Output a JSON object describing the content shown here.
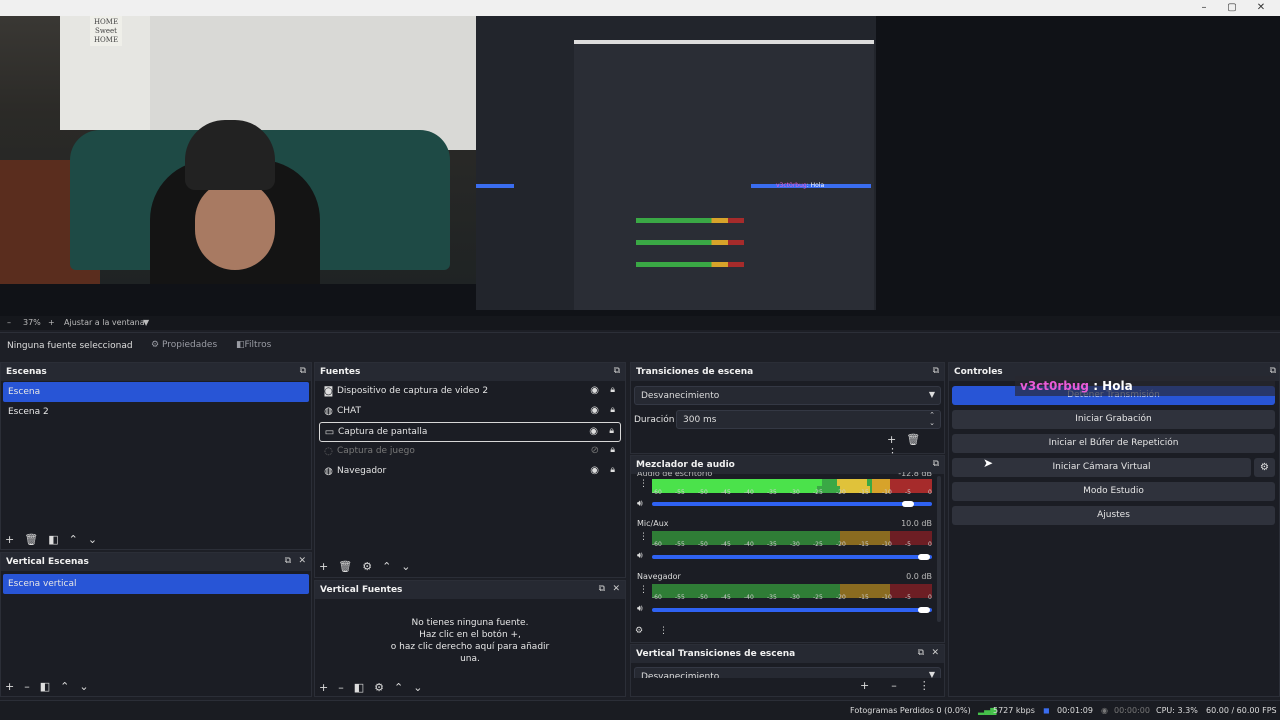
{
  "window": {
    "minimize": "–",
    "maximize": "▢",
    "close": "✕"
  },
  "preview": {
    "sign_text": "HOME Sweet HOME",
    "nested_chat_user": "v3ct0rbug",
    "nested_chat_msg": ": Hola"
  },
  "zoom": {
    "minus": "–",
    "percent": "37%",
    "plus": "+",
    "fit_label": "Ajustar a la ventana"
  },
  "source_toolbar": {
    "selected": "Ninguna fuente seleccionad",
    "properties": "Propiedades",
    "filters": "Filtros"
  },
  "scenes": {
    "title": "Escenas",
    "items": [
      {
        "label": "Escena",
        "selected": true
      },
      {
        "label": "Escena 2",
        "selected": false
      }
    ]
  },
  "sources": {
    "title": "Fuentes",
    "items": [
      {
        "label": "Dispositivo de captura de video 2",
        "icon": "camera-icon"
      },
      {
        "label": "CHAT",
        "icon": "globe-icon"
      },
      {
        "label": "Captura de pantalla",
        "icon": "monitor-icon"
      },
      {
        "label": "Captura de juego",
        "icon": "gamepad-icon"
      },
      {
        "label": "Navegador",
        "icon": "globe-icon"
      }
    ]
  },
  "transitions": {
    "title": "Transiciones de escena",
    "selected": "Desvanecimiento",
    "duration_label": "Duración",
    "duration_value": "300 ms"
  },
  "mixer": {
    "title": "Mezclador de audio",
    "top_label": "Audio de escritorio",
    "top_db": "-12.8 dB",
    "channels": [
      {
        "name": "Mic/Aux",
        "db": "10.0 dB"
      },
      {
        "name": "Navegador",
        "db": "0.0 dB"
      }
    ],
    "scale": [
      "-60",
      "-55",
      "-50",
      "-45",
      "-40",
      "-35",
      "-30",
      "-25",
      "-20",
      "-15",
      "-10",
      "-5",
      "0"
    ]
  },
  "controls": {
    "title": "Controles",
    "buttons": [
      "Detener Transmisión",
      "Iniciar Grabación",
      "Iniciar el Búfer de Repetición",
      "Iniciar Cámara Virtual",
      "Modo Estudio",
      "Ajustes"
    ]
  },
  "chat_overlay": {
    "user": "v3ct0rbug",
    "message": " : Hola",
    "user_color": "#e85bd6"
  },
  "vertical_scenes": {
    "title": "Vertical Escenas",
    "items": [
      {
        "label": "Escena vertical",
        "selected": true
      }
    ]
  },
  "vertical_sources": {
    "title": "Vertical Fuentes",
    "empty_lines": [
      "No tienes ninguna fuente.",
      "Haz clic en el botón +,",
      "o haz clic derecho aquí para añadir",
      "una."
    ]
  },
  "vertical_transitions": {
    "title": "Vertical Transiciones de escena",
    "selected": "Desvanecimiento"
  },
  "status": {
    "dropped": "Fotogramas Perdidos 0 (0.0%)",
    "bitrate": "5727 kbps",
    "stream_time": "00:01:09",
    "rec_time": "00:00:00",
    "cpu": "CPU: 3.3%",
    "fps": "60.00 / 60.00 FPS"
  },
  "colors": {
    "accent": "#2855d6",
    "meter_green": "#3aa845",
    "meter_yellow": "#d7a32a",
    "meter_red": "#a62b2b"
  }
}
